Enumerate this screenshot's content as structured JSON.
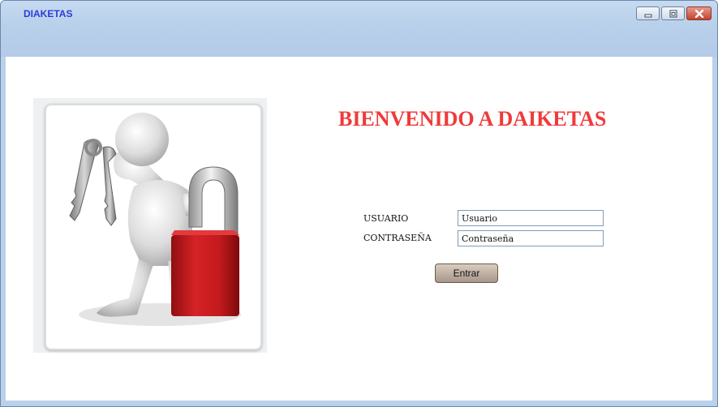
{
  "window": {
    "title": "DIAKETAS",
    "controls": {
      "minimize": "minimize-icon",
      "maximize": "maximize-icon",
      "close": "close-icon"
    },
    "colors": {
      "titlebar": "#b9d1ea",
      "title_text": "#2a3cd6"
    }
  },
  "login": {
    "heading": "BIENVENIDO A DAIKETAS",
    "heading_color": "#f03a3a",
    "username_label": "USUARIO",
    "username_value": "Usuario",
    "password_label": "CONTRASEÑA",
    "password_value": "Contraseña",
    "submit_label": "Entrar"
  },
  "illustration": {
    "icon": "security-figure-keys-padlock"
  }
}
